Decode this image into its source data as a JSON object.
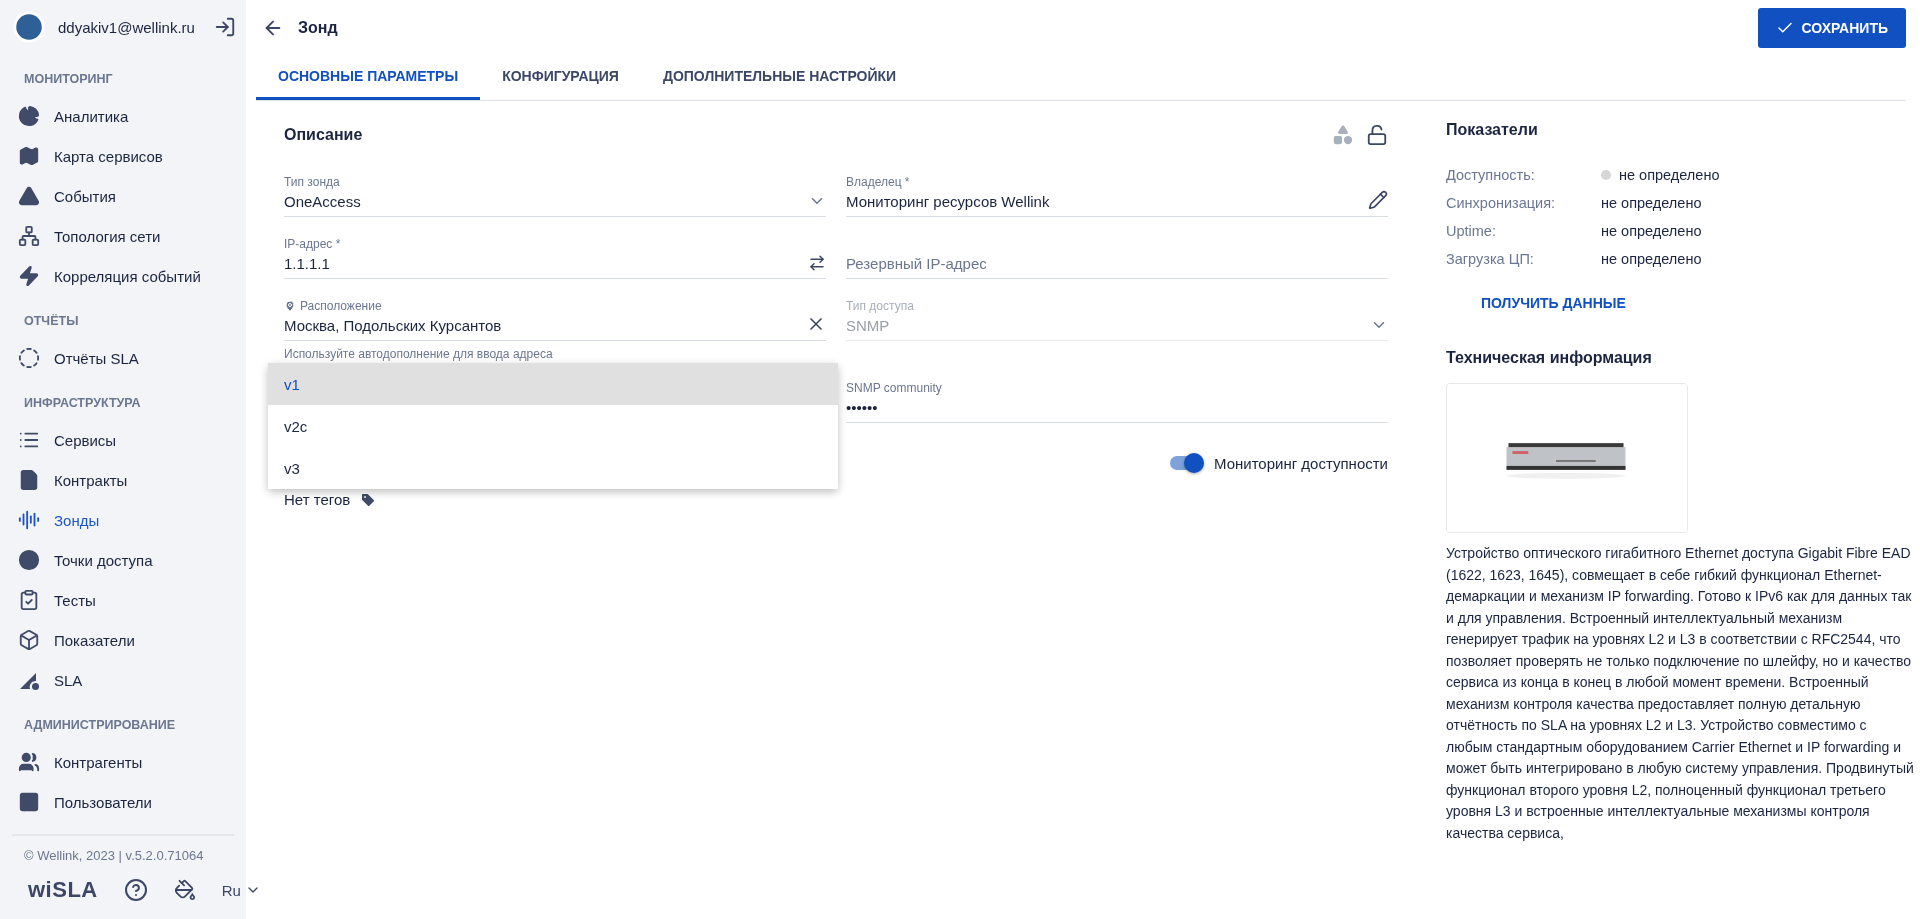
{
  "user": {
    "email": "ddyakiv1@wellink.ru"
  },
  "sidebar": {
    "sections": [
      {
        "title": "МОНИТОРИНГ",
        "items": [
          {
            "label": "Аналитика",
            "selected": false
          },
          {
            "label": "Карта сервисов",
            "selected": false
          },
          {
            "label": "События",
            "selected": false
          },
          {
            "label": "Топология сети",
            "selected": false
          },
          {
            "label": "Корреляция событий",
            "selected": false
          }
        ]
      },
      {
        "title": "ОТЧЁТЫ",
        "items": [
          {
            "label": "Отчёты SLA",
            "selected": false
          }
        ]
      },
      {
        "title": "ИНФРАСТРУКТУРА",
        "items": [
          {
            "label": "Сервисы",
            "selected": false
          },
          {
            "label": "Контракты",
            "selected": false
          },
          {
            "label": "Зонды",
            "selected": true
          },
          {
            "label": "Точки доступа",
            "selected": false
          },
          {
            "label": "Тесты",
            "selected": false
          },
          {
            "label": "Показатели",
            "selected": false
          },
          {
            "label": "SLA",
            "selected": false
          }
        ]
      },
      {
        "title": "АДМИНИСТРИРОВАНИЕ",
        "items": [
          {
            "label": "Контрагенты",
            "selected": false
          },
          {
            "label": "Пользователи",
            "selected": false
          }
        ]
      }
    ],
    "footer": "© Wellink, 2023 | v.5.2.0.71064",
    "logo": "wiSLA",
    "language": "Ru"
  },
  "header": {
    "title": "Зонд",
    "save_button": "СОХРАНИТЬ"
  },
  "tabs": [
    {
      "label": "ОСНОВНЫЕ ПАРАМЕТРЫ",
      "selected": true
    },
    {
      "label": "КОНФИГУРАЦИЯ",
      "selected": false
    },
    {
      "label": "ДОПОЛНИТЕЛЬНЫЕ НАСТРОЙКИ",
      "selected": false
    }
  ],
  "description": {
    "title": "Описание",
    "fields": [
      {
        "label": "Тип зонда",
        "value": "OneAccess",
        "disabled": false
      },
      {
        "label": "Владелец *",
        "value": "Мониторинг ресурсов Wellink",
        "disabled": false
      },
      {
        "label": "IP-адрес *",
        "value": "1.1.1.1",
        "disabled": false
      },
      {
        "placeholder": "Резервный IP-адрес",
        "disabled": false
      },
      {
        "label": "Расположение",
        "value": "Москва, Подольских Курсантов",
        "helper": "Используйте автодополнение для ввода адреса",
        "disabled": false
      },
      {
        "label": "Тип доступа",
        "value": "SNMP",
        "disabled": true
      },
      {
        "label": "SNMP community",
        "value": "••••••",
        "disabled": false
      }
    ],
    "menu": [
      {
        "label": "v1",
        "selected": true
      },
      {
        "label": "v2c",
        "selected": false
      },
      {
        "label": "v3",
        "selected": false
      }
    ],
    "toggle": {
      "label": "Мониторинг доступности",
      "on": true
    },
    "tags": "Нет тегов"
  },
  "metrics": {
    "title": "Показатели",
    "rows": [
      {
        "label": "Доступность:",
        "value": "не определено",
        "color": "#d6d6d6"
      },
      {
        "label": "Синхронизация:",
        "value": "не определено"
      },
      {
        "label": "Uptime:",
        "value": "не определено"
      },
      {
        "label": "Загрузка ЦП:",
        "value": "не определено"
      }
    ],
    "button": "ПОЛУЧИТЬ ДАННЫЕ"
  },
  "tech": {
    "title": "Техническая информация",
    "text": "Устройство оптического гигабитного Ethernet доступа Gigabit Fibre EAD (1622, 1623, 1645), совмещает в себе гибкий функционал Ethernet-демаркации и механизм IP forwarding. Готово к IPv6 как для данных так и для управления. Встроенный интеллектуальный механизм генерирует трафик на уровнях L2 и L3 в соответствии с RFC2544, что позволяет проверять не только подключение по шлейфу, но и качество сервиса из конца в конец в любой момент времени. Встроенный механизм контроля качества предоставляет полную детальную отчётность по SLA на уровнях L2 и L3. Устройство совместимо с любым стандартным оборудованием Carrier Ethernet и IP forwarding и может быть интегрировано в любую систему управления. Продвинутый функционал второго уровня L2, полноценный функционал третьего уровня L3 и встроенные интеллектуальные механизмы контроля качества сервиса,"
  }
}
